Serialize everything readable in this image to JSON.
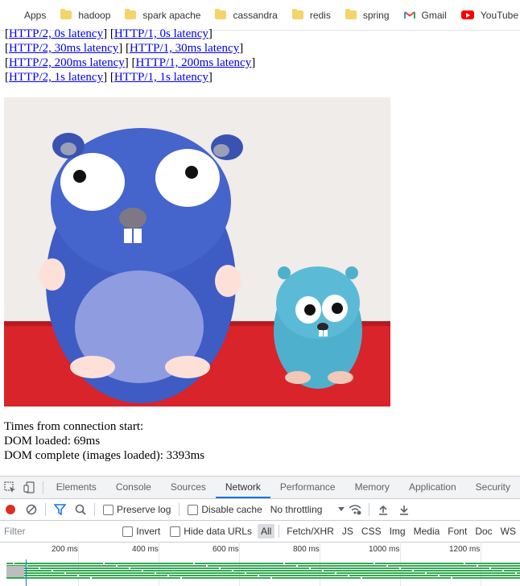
{
  "bookmarks": [
    {
      "label": "Apps",
      "icon": "apps-grid-icon"
    },
    {
      "label": "hadoop",
      "icon": "folder-icon"
    },
    {
      "label": "spark apache",
      "icon": "folder-icon"
    },
    {
      "label": "cassandra",
      "icon": "folder-icon"
    },
    {
      "label": "redis",
      "icon": "folder-icon"
    },
    {
      "label": "spring",
      "icon": "folder-icon"
    },
    {
      "label": "Gmail",
      "icon": "gmail-icon"
    },
    {
      "label": "YouTube",
      "icon": "youtube-icon"
    }
  ],
  "links": [
    {
      "h2": "HTTP/2, 0s latency",
      "h1": "HTTP/1, 0s latency"
    },
    {
      "h2": "HTTP/2, 30ms latency",
      "h1": "HTTP/1, 30ms latency"
    },
    {
      "h2": "HTTP/2, 200ms latency",
      "h1": "HTTP/1, 200ms latency"
    },
    {
      "h2": "HTTP/2, 1s latency",
      "h1": "HTTP/1, 1s latency"
    }
  ],
  "stats": {
    "heading": "Times from connection start:",
    "dom_loaded": "DOM loaded: 69ms",
    "dom_complete": "DOM complete (images loaded): 3393ms"
  },
  "devtools": {
    "tabs": [
      "Elements",
      "Console",
      "Sources",
      "Network",
      "Performance",
      "Memory",
      "Application",
      "Security"
    ],
    "active_tab": "Network",
    "preserve_log": "Preserve log",
    "disable_cache": "Disable cache",
    "throttling": "No throttling",
    "filter_placeholder": "Filter",
    "invert": "Invert",
    "hide_data_urls": "Hide data URLs",
    "types": [
      "All",
      "Fetch/XHR",
      "JS",
      "CSS",
      "Img",
      "Media",
      "Font",
      "Doc",
      "WS"
    ],
    "active_type": "All",
    "timeline_ticks": [
      "200 ms",
      "400 ms",
      "600 ms",
      "800 ms",
      "1000 ms",
      "1200 ms"
    ]
  },
  "colors": {
    "link": "#0000ee",
    "record": "#d93025",
    "accent": "#1a73e8",
    "timeline_bar": "#35a853"
  }
}
